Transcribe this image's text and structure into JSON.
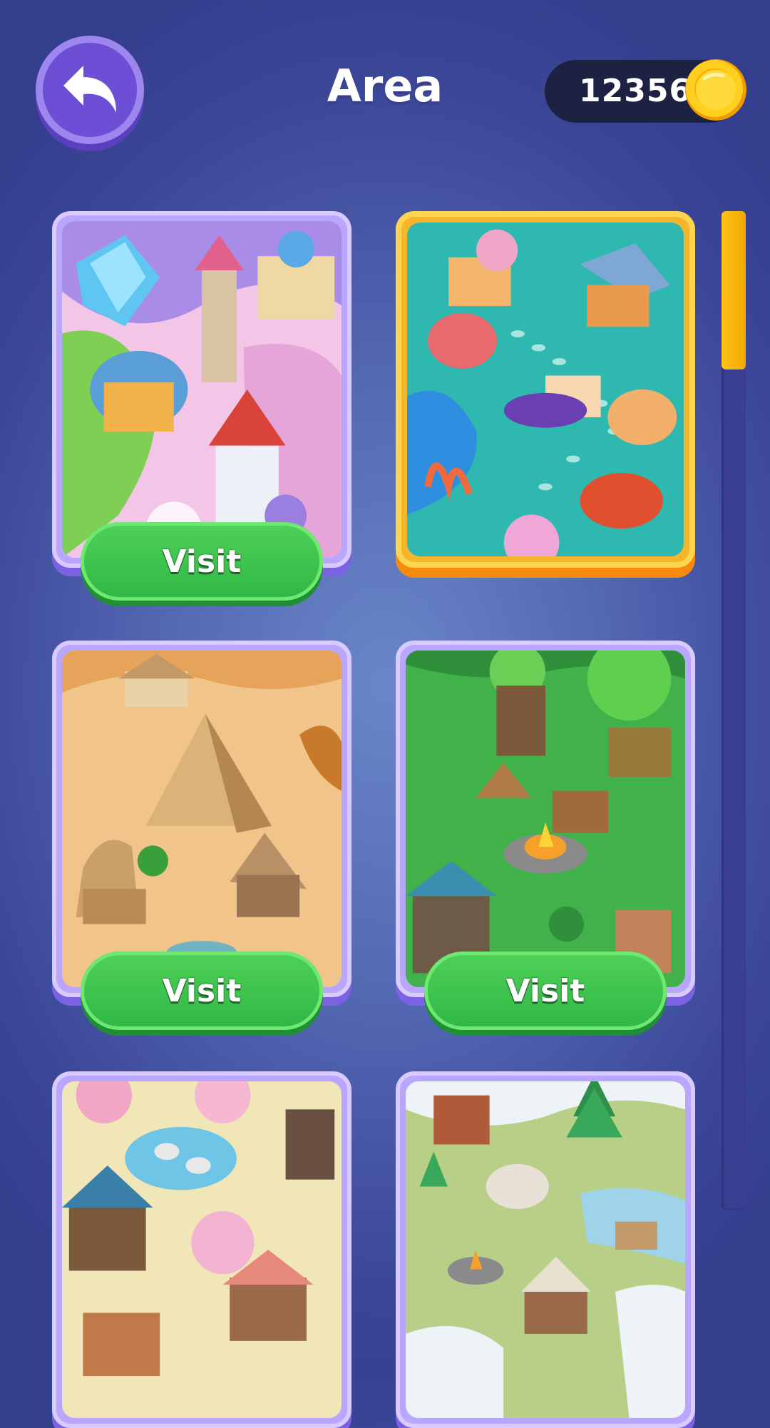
{
  "header": {
    "title": "Area",
    "coins": "12356"
  },
  "scroll": {
    "position": 0
  },
  "areas": [
    {
      "name": "fantasy-island",
      "visit_label": "Visit",
      "selected": false
    },
    {
      "name": "underwater-reef",
      "visit_label": "",
      "selected": true
    },
    {
      "name": "desert-pyramids",
      "visit_label": "Visit",
      "selected": false
    },
    {
      "name": "forest-camp",
      "visit_label": "Visit",
      "selected": false
    },
    {
      "name": "blossom-village",
      "visit_label": "",
      "selected": false
    },
    {
      "name": "snow-valley",
      "visit_label": "",
      "selected": false
    }
  ],
  "colors": {
    "accent": "#6d4fd6",
    "visit_green": "#3cc24d",
    "selected_gold": "#ffc21a"
  }
}
